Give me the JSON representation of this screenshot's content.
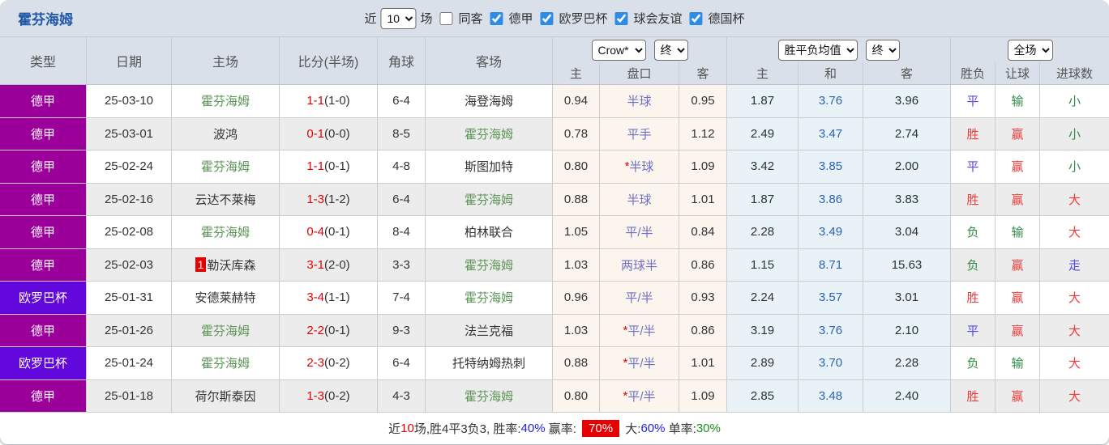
{
  "title": {
    "team": "霍芬海姆"
  },
  "topbar": {
    "recent_label": "近",
    "match_count": "10",
    "games_label": "场",
    "same_opponent_label": "同客",
    "same_opponent_checked": false,
    "league_filters": [
      {
        "label": "德甲",
        "checked": true
      },
      {
        "label": "欧罗巴杯",
        "checked": true
      },
      {
        "label": "球会友谊",
        "checked": true
      },
      {
        "label": "德国杯",
        "checked": true
      }
    ]
  },
  "columns": {
    "type": "类型",
    "date": "日期",
    "home": "主场",
    "score": "比分(半场)",
    "corners": "角球",
    "away": "客场"
  },
  "selectors": {
    "bookmaker": "Crow*",
    "bookmaker_stage": "终",
    "avg_label": "胜平负均值",
    "avg_stage": "终",
    "scope": "全场"
  },
  "sub_headers": [
    "主",
    "盘口",
    "客",
    "主",
    "和",
    "客",
    "胜负",
    "让球",
    "进球数"
  ],
  "league_colors": {
    "德甲": "#9b009b",
    "欧罗巴杯": "#6208dc"
  },
  "palette": {
    "red": "#ef3b3b",
    "blue": "#5246ef",
    "green": "#2e8b46",
    "score_red": "#e60000",
    "draw_odds_blue": "#2b63b8",
    "handicap_purple": "#6f6fc5",
    "title_blue": "#2158a8",
    "team_green": "#5a9455"
  },
  "rows": [
    {
      "league": "德甲",
      "date": "25-03-10",
      "home": {
        "name": "霍芬海姆",
        "highlight": true,
        "rank": ""
      },
      "score": {
        "ft": "1-1",
        "ht": "(1-0)"
      },
      "corners": "6-4",
      "away": {
        "name": "海登海姆",
        "highlight": false
      },
      "odds": {
        "home": "0.94",
        "star": "",
        "handicap": "半球",
        "away": "0.95"
      },
      "avg": {
        "home": "1.87",
        "draw": "3.76",
        "away": "3.96"
      },
      "result": {
        "text": "平",
        "color": "blue"
      },
      "handicap_result": {
        "text": "输",
        "color": "green"
      },
      "goals": {
        "text": "小",
        "color": "green"
      }
    },
    {
      "league": "德甲",
      "date": "25-03-01",
      "home": {
        "name": "波鸿",
        "highlight": false,
        "rank": ""
      },
      "score": {
        "ft": "0-1",
        "ht": "(0-0)"
      },
      "corners": "8-5",
      "away": {
        "name": "霍芬海姆",
        "highlight": true
      },
      "odds": {
        "home": "0.78",
        "star": "",
        "handicap": "平手",
        "away": "1.12"
      },
      "avg": {
        "home": "2.49",
        "draw": "3.47",
        "away": "2.74"
      },
      "result": {
        "text": "胜",
        "color": "red"
      },
      "handicap_result": {
        "text": "赢",
        "color": "red"
      },
      "goals": {
        "text": "小",
        "color": "green"
      }
    },
    {
      "league": "德甲",
      "date": "25-02-24",
      "home": {
        "name": "霍芬海姆",
        "highlight": true,
        "rank": ""
      },
      "score": {
        "ft": "1-1",
        "ht": "(0-1)"
      },
      "corners": "4-8",
      "away": {
        "name": "斯图加特",
        "highlight": false
      },
      "odds": {
        "home": "0.80",
        "star": "*",
        "handicap": "半球",
        "away": "1.09"
      },
      "avg": {
        "home": "3.42",
        "draw": "3.85",
        "away": "2.00"
      },
      "result": {
        "text": "平",
        "color": "blue"
      },
      "handicap_result": {
        "text": "赢",
        "color": "red"
      },
      "goals": {
        "text": "小",
        "color": "green"
      }
    },
    {
      "league": "德甲",
      "date": "25-02-16",
      "home": {
        "name": "云达不莱梅",
        "highlight": false,
        "rank": ""
      },
      "score": {
        "ft": "1-3",
        "ht": "(1-2)"
      },
      "corners": "6-4",
      "away": {
        "name": "霍芬海姆",
        "highlight": true
      },
      "odds": {
        "home": "0.88",
        "star": "",
        "handicap": "半球",
        "away": "1.01"
      },
      "avg": {
        "home": "1.87",
        "draw": "3.86",
        "away": "3.83"
      },
      "result": {
        "text": "胜",
        "color": "red"
      },
      "handicap_result": {
        "text": "赢",
        "color": "red"
      },
      "goals": {
        "text": "大",
        "color": "red"
      }
    },
    {
      "league": "德甲",
      "date": "25-02-08",
      "home": {
        "name": "霍芬海姆",
        "highlight": true,
        "rank": ""
      },
      "score": {
        "ft": "0-4",
        "ht": "(0-1)"
      },
      "corners": "8-4",
      "away": {
        "name": "柏林联合",
        "highlight": false
      },
      "odds": {
        "home": "1.05",
        "star": "",
        "handicap": "平/半",
        "away": "0.84"
      },
      "avg": {
        "home": "2.28",
        "draw": "3.49",
        "away": "3.04"
      },
      "result": {
        "text": "负",
        "color": "green"
      },
      "handicap_result": {
        "text": "输",
        "color": "green"
      },
      "goals": {
        "text": "大",
        "color": "red"
      }
    },
    {
      "league": "德甲",
      "date": "25-02-03",
      "home": {
        "name": "勒沃库森",
        "highlight": false,
        "rank": "1"
      },
      "score": {
        "ft": "3-1",
        "ht": "(2-0)"
      },
      "corners": "3-3",
      "away": {
        "name": "霍芬海姆",
        "highlight": true
      },
      "odds": {
        "home": "1.03",
        "star": "",
        "handicap": "两球半",
        "away": "0.86"
      },
      "avg": {
        "home": "1.15",
        "draw": "8.71",
        "away": "15.63"
      },
      "result": {
        "text": "负",
        "color": "green"
      },
      "handicap_result": {
        "text": "赢",
        "color": "red"
      },
      "goals": {
        "text": "走",
        "color": "blue"
      }
    },
    {
      "league": "欧罗巴杯",
      "date": "25-01-31",
      "home": {
        "name": "安德莱赫特",
        "highlight": false,
        "rank": ""
      },
      "score": {
        "ft": "3-4",
        "ht": "(1-1)"
      },
      "corners": "7-4",
      "away": {
        "name": "霍芬海姆",
        "highlight": true
      },
      "odds": {
        "home": "0.96",
        "star": "",
        "handicap": "平/半",
        "away": "0.93"
      },
      "avg": {
        "home": "2.24",
        "draw": "3.57",
        "away": "3.01"
      },
      "result": {
        "text": "胜",
        "color": "red"
      },
      "handicap_result": {
        "text": "赢",
        "color": "red"
      },
      "goals": {
        "text": "大",
        "color": "red"
      }
    },
    {
      "league": "德甲",
      "date": "25-01-26",
      "home": {
        "name": "霍芬海姆",
        "highlight": true,
        "rank": ""
      },
      "score": {
        "ft": "2-2",
        "ht": "(0-1)"
      },
      "corners": "9-3",
      "away": {
        "name": "法兰克福",
        "highlight": false
      },
      "odds": {
        "home": "1.03",
        "star": "*",
        "handicap": "平/半",
        "away": "0.86"
      },
      "avg": {
        "home": "3.19",
        "draw": "3.76",
        "away": "2.10"
      },
      "result": {
        "text": "平",
        "color": "blue"
      },
      "handicap_result": {
        "text": "赢",
        "color": "red"
      },
      "goals": {
        "text": "大",
        "color": "red"
      }
    },
    {
      "league": "欧罗巴杯",
      "date": "25-01-24",
      "home": {
        "name": "霍芬海姆",
        "highlight": true,
        "rank": ""
      },
      "score": {
        "ft": "2-3",
        "ht": "(0-2)"
      },
      "corners": "6-4",
      "away": {
        "name": "托特纳姆热刺",
        "highlight": false
      },
      "odds": {
        "home": "0.88",
        "star": "*",
        "handicap": "平/半",
        "away": "1.01"
      },
      "avg": {
        "home": "2.89",
        "draw": "3.70",
        "away": "2.28"
      },
      "result": {
        "text": "负",
        "color": "green"
      },
      "handicap_result": {
        "text": "输",
        "color": "green"
      },
      "goals": {
        "text": "大",
        "color": "red"
      }
    },
    {
      "league": "德甲",
      "date": "25-01-18",
      "home": {
        "name": "荷尔斯泰因",
        "highlight": false,
        "rank": ""
      },
      "score": {
        "ft": "1-3",
        "ht": "(0-2)"
      },
      "corners": "4-3",
      "away": {
        "name": "霍芬海姆",
        "highlight": true
      },
      "odds": {
        "home": "0.80",
        "star": "*",
        "handicap": "平/半",
        "away": "1.09"
      },
      "avg": {
        "home": "2.85",
        "draw": "3.48",
        "away": "2.40"
      },
      "result": {
        "text": "胜",
        "color": "red"
      },
      "handicap_result": {
        "text": "赢",
        "color": "red"
      },
      "goals": {
        "text": "大",
        "color": "red"
      }
    }
  ],
  "footer": {
    "segments": [
      {
        "text": "近",
        "color": "#333333"
      },
      {
        "text": "10",
        "color": "#e60000"
      },
      {
        "text": "场,胜4平3负3, 胜率:",
        "color": "#333333"
      },
      {
        "text": "40%",
        "color": "#2222dd"
      },
      {
        "text": " 赢率: ",
        "color": "#333333"
      },
      {
        "text": "70%",
        "color": "#ffffff",
        "bg": "#e60000"
      },
      {
        "text": " 大:",
        "color": "#333333"
      },
      {
        "text": "60%",
        "color": "#2222dd"
      },
      {
        "text": " 单率:",
        "color": "#333333"
      },
      {
        "text": "30%",
        "color": "#1f8c1f"
      }
    ]
  }
}
